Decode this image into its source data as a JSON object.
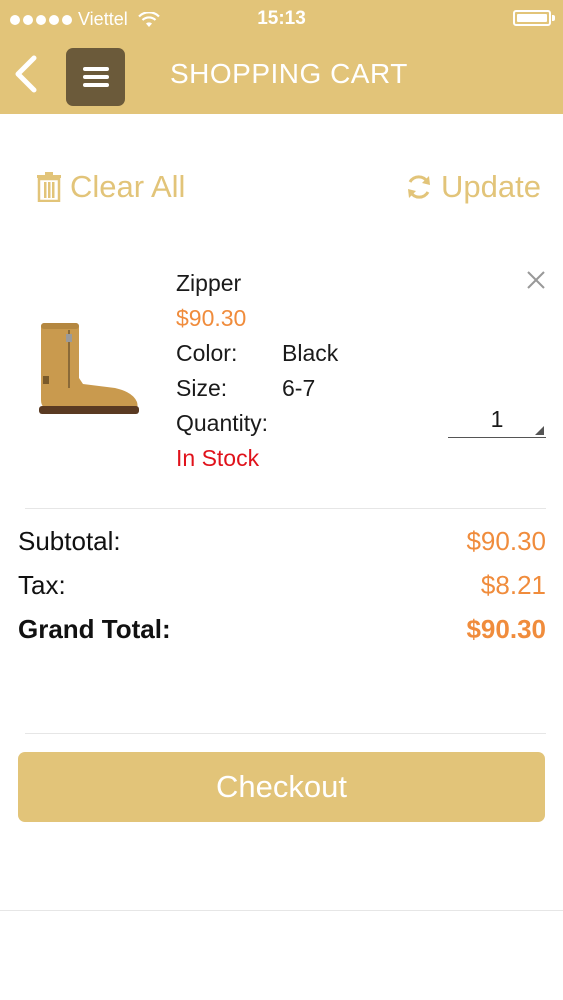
{
  "status_bar": {
    "carrier": "Viettel",
    "time": "15:13",
    "signal_dots": 5,
    "battery_level": 1.0
  },
  "nav": {
    "back_icon": "chevron-left-icon",
    "menu_icon": "hamburger-icon",
    "title": "SHOPPING CART"
  },
  "actions": {
    "clear_all": "Clear All",
    "update": "Update"
  },
  "cart_item": {
    "name": "Zipper",
    "price": "$90.30",
    "color_label": "Color:",
    "color_value": "Black",
    "size_label": "Size:",
    "size_value": "6-7",
    "quantity_label": "Quantity:",
    "quantity_value": "1",
    "stock_status": "In Stock"
  },
  "totals": {
    "subtotal_label": "Subtotal:",
    "subtotal_value": "$90.30",
    "tax_label": "Tax:",
    "tax_value": "$8.21",
    "grand_total_label": "Grand Total:",
    "grand_total_value": "$90.30"
  },
  "checkout_label": "Checkout",
  "colors": {
    "brand_gold": "#e2c479",
    "menu_button": "#6b5a3a",
    "price_orange": "#f08c3c",
    "in_stock_red": "#e0121b"
  }
}
